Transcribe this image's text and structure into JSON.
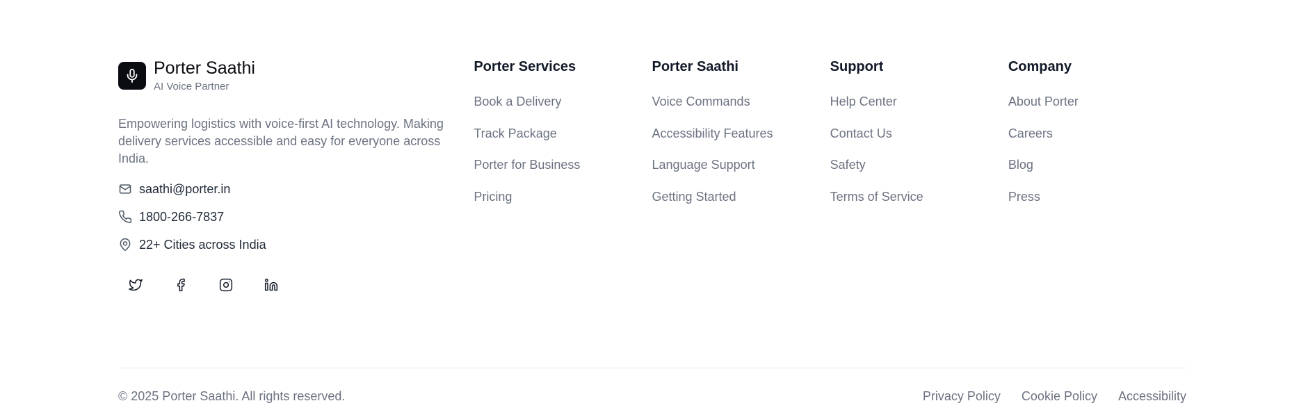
{
  "brand": {
    "name": "Porter Saathi",
    "tagline": "AI Voice Partner",
    "description": "Empowering logistics with voice-first AI technology. Making delivery services accessible and easy for everyone across India."
  },
  "contacts": [
    {
      "icon": "mail-icon",
      "text": "saathi@porter.in"
    },
    {
      "icon": "phone-icon",
      "text": "1800-266-7837"
    },
    {
      "icon": "map-pin-icon",
      "text": "22+ Cities across India"
    }
  ],
  "social": [
    "twitter-icon",
    "facebook-icon",
    "instagram-icon",
    "linkedin-icon"
  ],
  "columns": [
    {
      "title": "Porter Services",
      "links": [
        "Book a Delivery",
        "Track Package",
        "Porter for Business",
        "Pricing"
      ]
    },
    {
      "title": "Porter Saathi",
      "links": [
        "Voice Commands",
        "Accessibility Features",
        "Language Support",
        "Getting Started"
      ]
    },
    {
      "title": "Support",
      "links": [
        "Help Center",
        "Contact Us",
        "Safety",
        "Terms of Service"
      ]
    },
    {
      "title": "Company",
      "links": [
        "About Porter",
        "Careers",
        "Blog",
        "Press"
      ]
    }
  ],
  "bottom": {
    "copyright": "© 2025 Porter Saathi. All rights reserved.",
    "legal": [
      "Privacy Policy",
      "Cookie Policy",
      "Accessibility"
    ]
  },
  "colors": {
    "logo_bg": "#0b0b12",
    "muted_text": "#6b7280",
    "divider": "#e5e7eb"
  }
}
